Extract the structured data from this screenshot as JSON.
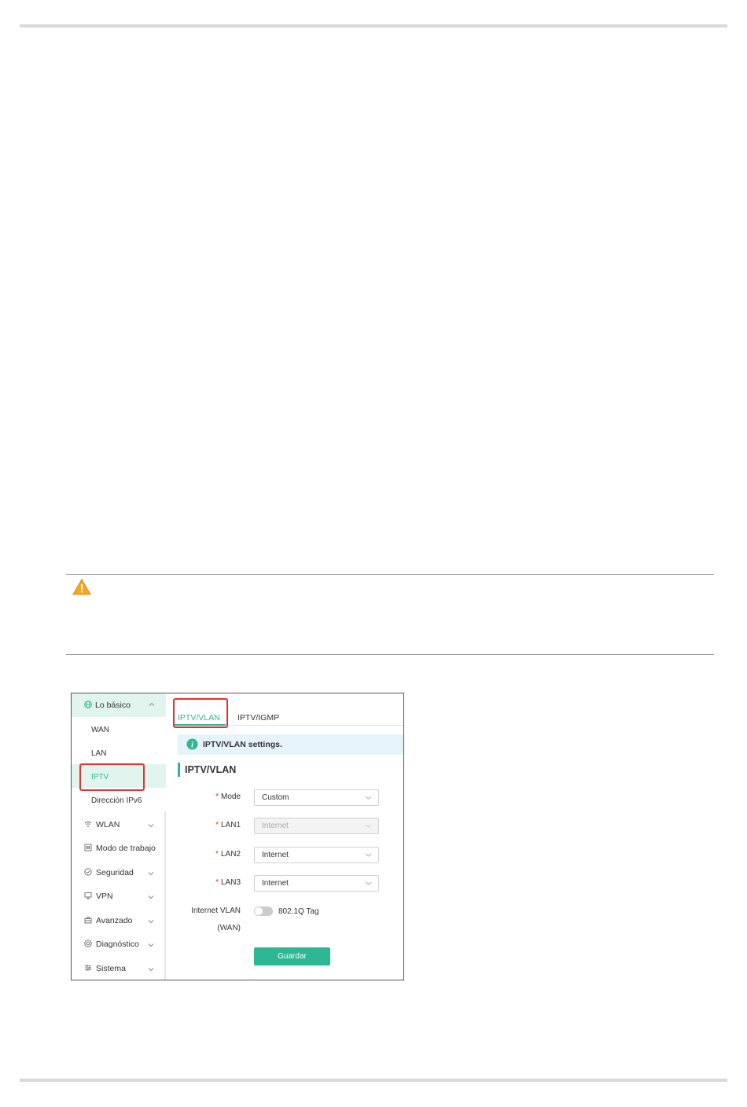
{
  "sidebar": {
    "group_label": "Lo básico",
    "sub_items": [
      "WAN",
      "LAN",
      "IPTV",
      "Dirección IPv6"
    ],
    "items": [
      {
        "label": "WLAN",
        "icon": "wifi-icon"
      },
      {
        "label": "Modo de trabajo",
        "icon": "mode-icon"
      },
      {
        "label": "Seguridad",
        "icon": "shield-icon"
      },
      {
        "label": "VPN",
        "icon": "monitor-icon"
      },
      {
        "label": "Avanzado",
        "icon": "toolbox-icon"
      },
      {
        "label": "Diagnóstico",
        "icon": "diagnostic-icon"
      },
      {
        "label": "Sistema",
        "icon": "sliders-icon"
      }
    ]
  },
  "tabs": [
    "IPTV/VLAN",
    "IPTV/IGMP"
  ],
  "info_text": "IPTV/VLAN settings.",
  "section_title": "IPTV/VLAN",
  "form": {
    "fields": [
      {
        "label": "Mode",
        "value": "Custom",
        "disabled": false
      },
      {
        "label": "LAN1",
        "value": "Internet",
        "disabled": true
      },
      {
        "label": "LAN2",
        "value": "Internet",
        "disabled": false
      },
      {
        "label": "LAN3",
        "value": "Internet",
        "disabled": false
      }
    ],
    "vlan_label_line1": "Internet VLAN",
    "vlan_label_line2": "(WAN)",
    "tag_label": "802.1Q Tag",
    "save_label": "Guardar"
  },
  "colors": {
    "accent": "#2eb794",
    "highlight": "#e53030",
    "active_bg": "#e1f5ee",
    "info_bg": "#e7f3fb"
  }
}
